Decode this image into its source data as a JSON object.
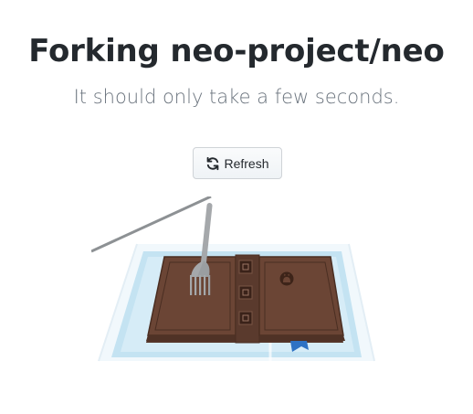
{
  "header": {
    "title": "Forking neo-project/neo",
    "subtitle": "It should only take a few seconds."
  },
  "actions": {
    "refresh_label": "Refresh",
    "refresh_icon": "sync-icon"
  },
  "illustration": {
    "description_icon": "fork-and-book-illustration",
    "colors": {
      "book": "#6b4535",
      "book_border": "#4a2e22",
      "water": "#bfe0f0",
      "fork": "#a5a8ab",
      "ribbon": "#2d72c4"
    }
  }
}
